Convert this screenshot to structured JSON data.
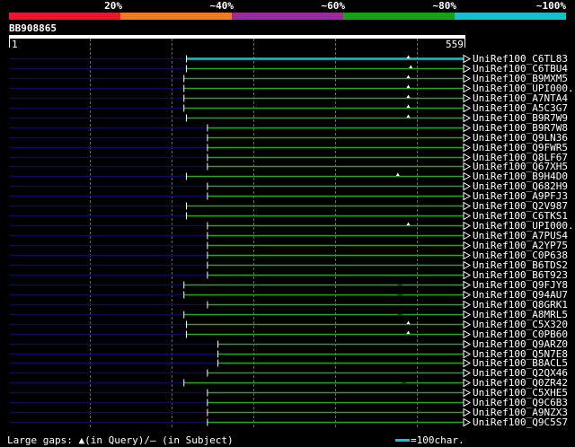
{
  "scale": {
    "segments": [
      {
        "color": "#e8182a"
      },
      {
        "color": "#ef7b1a"
      },
      {
        "color": "#9a2b9a"
      },
      {
        "color": "#15a315"
      },
      {
        "color": "#18bfc8"
      }
    ],
    "labels": [
      "20%",
      "~40%",
      "~60%",
      "~80%",
      "~100%"
    ]
  },
  "query": {
    "id": "BB908865",
    "start": "1",
    "end": "559",
    "length": 559
  },
  "colors": {
    "subject_line": "#0b0b5a",
    "hit_green": "#1ea81e",
    "hit_cyan": "#18bfc8"
  },
  "hits": [
    {
      "name": "UniRef100_C6TL83",
      "start": 219,
      "end": 559,
      "color": "cyan",
      "gap": 493
    },
    {
      "name": "UniRef100_C6TBU4",
      "start": 219,
      "end": 559,
      "color": "green",
      "gap": 496
    },
    {
      "name": "UniRef100_B9MXM5",
      "start": 216,
      "end": 559,
      "color": "green",
      "gap": 493
    },
    {
      "name": "UniRef100_UPI000...",
      "start": 216,
      "end": 559,
      "color": "green",
      "gap": 493
    },
    {
      "name": "UniRef100_A7NTA4",
      "start": 216,
      "end": 559,
      "color": "green",
      "gap": 493
    },
    {
      "name": "UniRef100_A5C3G7",
      "start": 216,
      "end": 559,
      "color": "green",
      "gap": 493
    },
    {
      "name": "UniRef100_B9R7W9",
      "start": 219,
      "end": 559,
      "color": "green",
      "gap": 493
    },
    {
      "name": "UniRef100_B9R7W8",
      "start": 245,
      "end": 559,
      "color": "green"
    },
    {
      "name": "UniRef100_Q9LN36",
      "start": 245,
      "end": 559,
      "color": "green"
    },
    {
      "name": "UniRef100_Q9FWR5",
      "start": 245,
      "end": 559,
      "color": "green"
    },
    {
      "name": "UniRef100_Q8LF67",
      "start": 245,
      "end": 559,
      "color": "green"
    },
    {
      "name": "UniRef100_Q67XH5",
      "start": 245,
      "end": 559,
      "color": "green"
    },
    {
      "name": "UniRef100_B9H4D0",
      "start": 219,
      "end": 559,
      "color": "green",
      "gap": 480
    },
    {
      "name": "UniRef100_Q682H9",
      "start": 245,
      "end": 559,
      "color": "green"
    },
    {
      "name": "UniRef100_A9PFJ3",
      "start": 245,
      "end": 559,
      "color": "green"
    },
    {
      "name": "UniRef100_Q2V987",
      "start": 219,
      "end": 559,
      "color": "green"
    },
    {
      "name": "UniRef100_C6TKS1",
      "start": 219,
      "end": 559,
      "color": "green"
    },
    {
      "name": "UniRef100_UPI000...",
      "start": 245,
      "end": 559,
      "color": "green",
      "gap": 493
    },
    {
      "name": "UniRef100_A7PUS4",
      "start": 245,
      "end": 559,
      "color": "green"
    },
    {
      "name": "UniRef100_A2YP75",
      "start": 245,
      "end": 559,
      "color": "green"
    },
    {
      "name": "UniRef100_C0P638",
      "start": 245,
      "end": 559,
      "color": "green"
    },
    {
      "name": "UniRef100_B6TDS2",
      "start": 245,
      "end": 559,
      "color": "green"
    },
    {
      "name": "UniRef100_B6T923",
      "start": 245,
      "end": 559,
      "color": "green"
    },
    {
      "name": "UniRef100_Q9FJY8",
      "start": 216,
      "end": 559,
      "color": "green",
      "dash": 480
    },
    {
      "name": "UniRef100_Q94AU7",
      "start": 216,
      "end": 559,
      "color": "green",
      "dash": 480
    },
    {
      "name": "UniRef100_Q8GRK1",
      "start": 245,
      "end": 559,
      "color": "green"
    },
    {
      "name": "UniRef100_A8MRL5",
      "start": 216,
      "end": 559,
      "color": "green",
      "dash": 480
    },
    {
      "name": "UniRef100_C5X320",
      "start": 219,
      "end": 559,
      "color": "green",
      "gap": 493
    },
    {
      "name": "UniRef100_C0PB60",
      "start": 219,
      "end": 559,
      "color": "green",
      "gap": 493
    },
    {
      "name": "UniRef100_Q9ARZ0",
      "start": 258,
      "end": 559,
      "color": "green"
    },
    {
      "name": "UniRef100_Q5N7E8",
      "start": 258,
      "end": 559,
      "color": "green"
    },
    {
      "name": "UniRef100_B8ACL5",
      "start": 258,
      "end": 559,
      "color": "green"
    },
    {
      "name": "UniRef100_Q2QX46",
      "start": 245,
      "end": 559,
      "color": "green"
    },
    {
      "name": "UniRef100_Q0ZR42",
      "start": 216,
      "end": 559,
      "color": "green",
      "dash": 485
    },
    {
      "name": "UniRef100_C5XHE5",
      "start": 245,
      "end": 559,
      "color": "green"
    },
    {
      "name": "UniRef100_Q9C6B3",
      "start": 245,
      "end": 559,
      "color": "green"
    },
    {
      "name": "UniRef100_A9NZX3",
      "start": 245,
      "end": 559,
      "color": "green"
    },
    {
      "name": "UniRef100_Q9C5S7",
      "start": 245,
      "end": 559,
      "color": "green"
    }
  ],
  "footer": {
    "text": "Large gaps: ▲(in Query)/— (in Subject)",
    "legend": "=100char."
  }
}
